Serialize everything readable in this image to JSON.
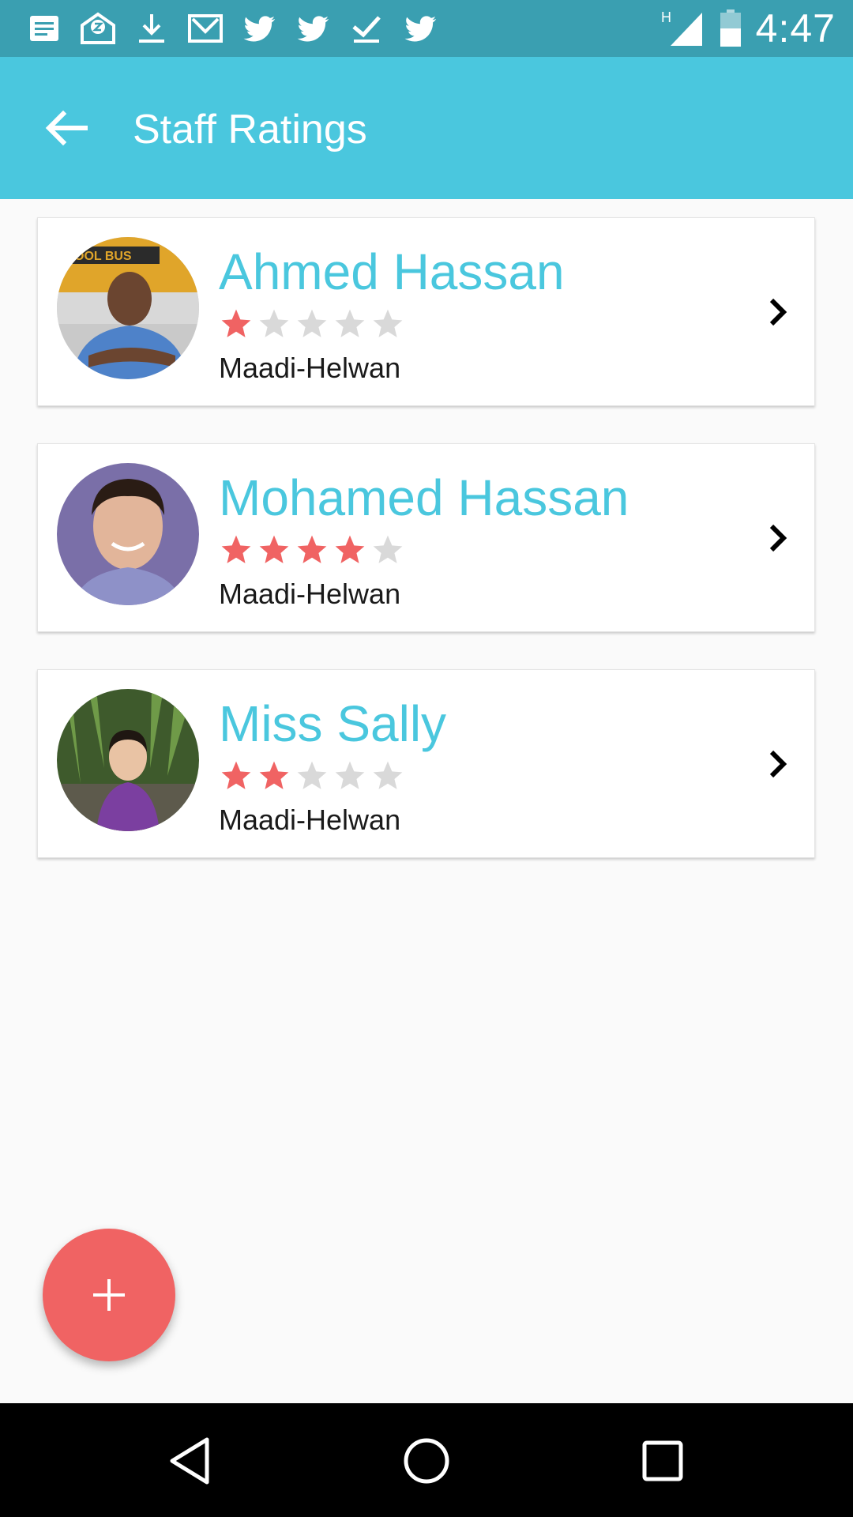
{
  "status_bar": {
    "time": "4:47",
    "network_type": "H",
    "notification_icons": [
      "notes-icon",
      "mail-z-icon",
      "download-icon",
      "gmail-icon",
      "twitter-icon",
      "twitter-icon",
      "checkmark-icon",
      "twitter-icon"
    ]
  },
  "app_bar": {
    "title": "Staff Ratings",
    "back_icon": "arrow-back-icon"
  },
  "staff": [
    {
      "name": "Ahmed Hassan",
      "rating": 1,
      "max_rating": 5,
      "area": "Maadi-Helwan"
    },
    {
      "name": "Mohamed Hassan",
      "rating": 4,
      "max_rating": 5,
      "area": "Maadi-Helwan"
    },
    {
      "name": "Miss Sally",
      "rating": 2,
      "max_rating": 5,
      "area": "Maadi-Helwan"
    }
  ],
  "fab": {
    "icon": "plus-icon"
  },
  "nav_bar": {
    "buttons": [
      "back-triangle-icon",
      "home-circle-icon",
      "recents-square-icon"
    ]
  },
  "colors": {
    "status_bar": "#3a9fb1",
    "app_bar": "#4ac7de",
    "accent_name": "#4ac7de",
    "star_filled": "#f06363",
    "star_empty": "#d9d9d9",
    "fab": "#f06363",
    "background": "#fafafa"
  }
}
